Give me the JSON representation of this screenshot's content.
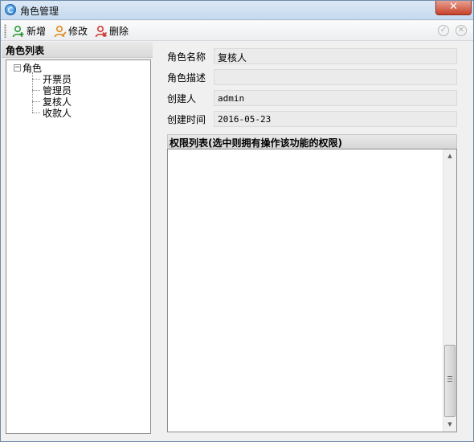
{
  "window": {
    "title": "角色管理",
    "close_glyph": "✕"
  },
  "toolbar": {
    "buttons": [
      {
        "label": "新增",
        "icon": "add-user-icon",
        "color": "#2e9a3c"
      },
      {
        "label": "修改",
        "icon": "edit-user-icon",
        "color": "#e08a1e"
      },
      {
        "label": "删除",
        "icon": "delete-user-icon",
        "color": "#d23a3a"
      }
    ],
    "right_icons": [
      "confirm-icon",
      "cancel-icon"
    ]
  },
  "left": {
    "header": "角色列表",
    "tree": {
      "root": {
        "label": "角色",
        "toggle": "−"
      },
      "children": [
        "开票员",
        "管理员",
        "复核人",
        "收款人"
      ]
    }
  },
  "form": {
    "fields": [
      {
        "label": "角色名称",
        "value": "复核人"
      },
      {
        "label": "角色描述",
        "value": ""
      },
      {
        "label": "创建人",
        "value": "admin"
      },
      {
        "label": "创建时间",
        "value": "2016-05-23"
      }
    ]
  },
  "permissions": {
    "header": "权限列表(选中则拥有操作该功能的权限)"
  }
}
